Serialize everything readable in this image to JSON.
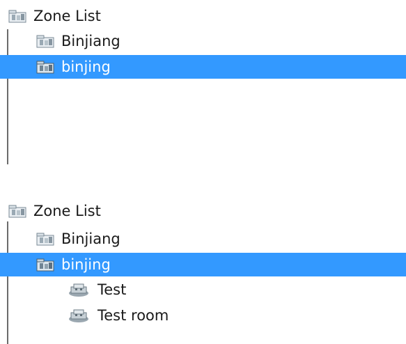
{
  "top_panel": {
    "root_label": "Zone List",
    "items": [
      {
        "label": "Binjiang",
        "selected": false
      },
      {
        "label": "binjing",
        "selected": true
      }
    ]
  },
  "bottom_panel": {
    "root_label": "Zone List",
    "items": [
      {
        "label": "Binjiang",
        "selected": false
      },
      {
        "label": "binjing",
        "selected": true
      }
    ],
    "children": [
      {
        "label": "Test"
      },
      {
        "label": "Test room"
      }
    ]
  },
  "icons": {
    "zone": "zone-icon",
    "room": "room-icon"
  },
  "colors": {
    "selection": "#3399ff",
    "selection_text": "#ffffff"
  }
}
